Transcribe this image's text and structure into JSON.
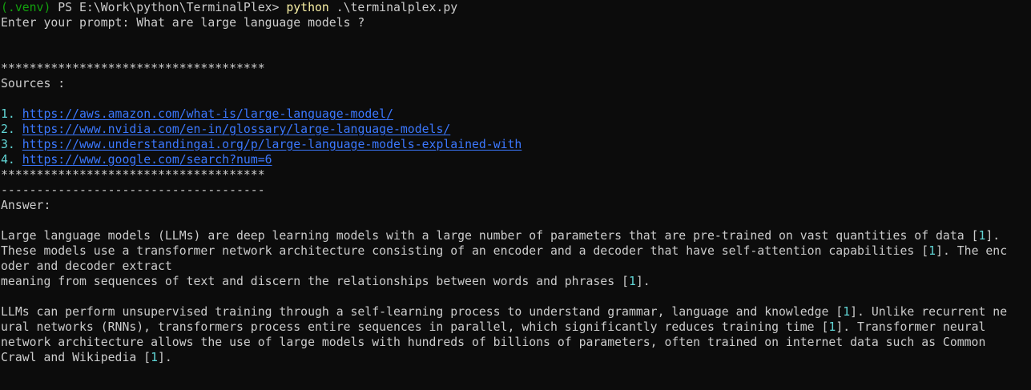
{
  "prompt_line": {
    "venv": "(.venv)",
    "ps_path": " PS E:\\Work\\python\\TerminalPlex> ",
    "command": "python",
    "args": " .\\terminalplex.py"
  },
  "input_line": "Enter your prompt: What are large language models ?",
  "stars": "*************************************",
  "sources_label": "Sources :",
  "sources": [
    {
      "num": "1.",
      "url": "https://aws.amazon.com/what-is/large-language-model/"
    },
    {
      "num": "2.",
      "url": "https://www.nvidia.com/en-in/glossary/large-language-models/"
    },
    {
      "num": "3.",
      "url": "https://www.understandingai.org/p/large-language-models-explained-with"
    },
    {
      "num": "4.",
      "url": "https://www.google.com/search?num=6"
    }
  ],
  "dashes": "-------------------------------------",
  "answer_label": "Answer:",
  "p1": {
    "l1a": "Large language models (LLMs) are deep learning models with a large number of parameters that are pre-trained on vast quantities of data [",
    "l1c": "1",
    "l1b": "].",
    "l2a": "These models use a transformer network architecture consisting of an encoder and a decoder that have self-attention capabilities [",
    "l2c": "1",
    "l2b": "]. The enc",
    "l3": "oder and decoder extract",
    "l4a": "meaning from sequences of text and discern the relationships between words and phrases [",
    "l4c": "1",
    "l4b": "]."
  },
  "p2": {
    "l1a": "LLMs can perform unsupervised training through a self-learning process to understand grammar, language and knowledge [",
    "l1c": "1",
    "l1b": "]. Unlike recurrent ne",
    "l2a": "ural networks (RNNs), transformers process entire sequences in parallel, which significantly reduces training time [",
    "l2c": "1",
    "l2b": "]. Transformer neural",
    "l3": "network architecture allows the use of large models with hundreds of billions of parameters, often trained on internet data such as Common",
    "l4a": "Crawl and Wikipedia [",
    "l4c": "1",
    "l4b": "]."
  },
  "colors": {
    "background": "#0c0c0c",
    "text": "#cccccc",
    "venv": "#13a10e",
    "command": "#f9f1a5",
    "link": "#3b78ff",
    "citation": "#61d6d6"
  }
}
